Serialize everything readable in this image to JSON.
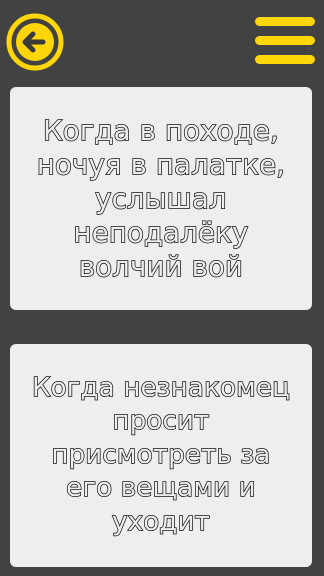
{
  "header": {
    "back_icon": "arrow-left-circle-icon",
    "menu_icon": "hamburger-menu-icon",
    "accent_color": "#ffd60a"
  },
  "cards": [
    {
      "text": "Когда в походе,\nночуя в палатке,\nуслышал\nнеподалёку\nволчий вой"
    },
    {
      "text": "Когда незнакомец\nпросит\nприсмотреть за\nего вещами и\nуходит"
    }
  ]
}
